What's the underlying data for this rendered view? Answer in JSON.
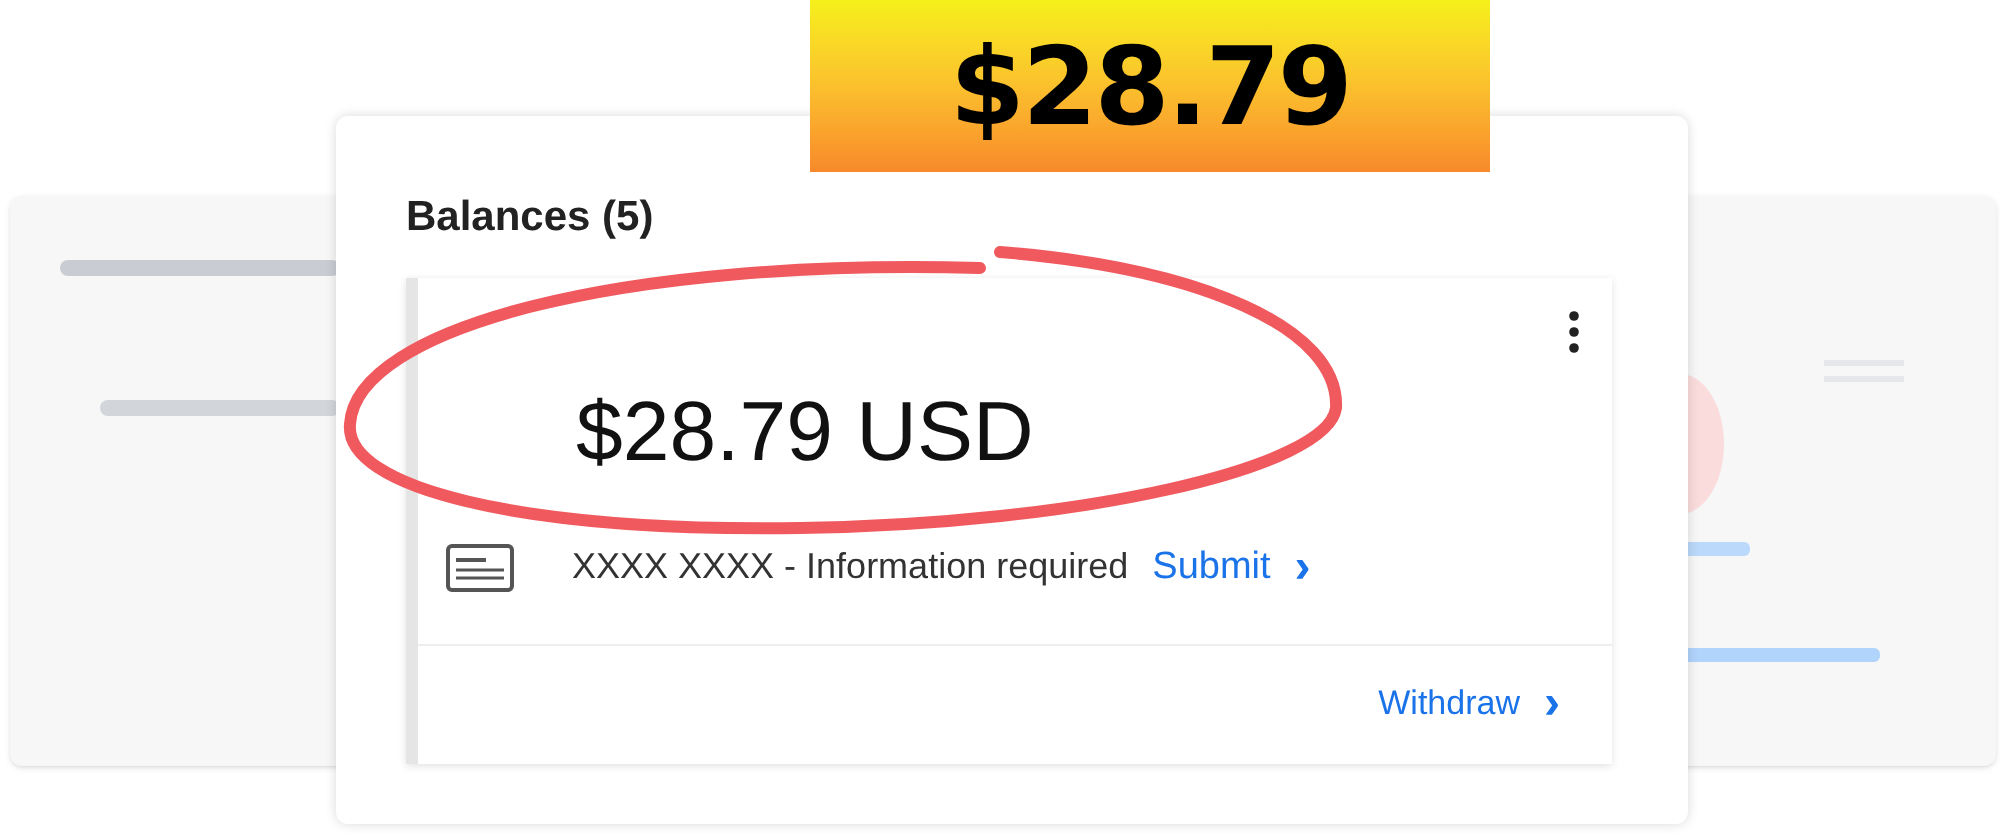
{
  "banner": {
    "amount": "$28.79"
  },
  "balances": {
    "title": "Balances (5)"
  },
  "balance_card": {
    "amount": "$28.79 USD",
    "notice": "XXXX XXXX - Information required",
    "action": "Submit",
    "action_chevron": "›",
    "withdraw": "Withdraw",
    "withdraw_chevron": "›"
  }
}
